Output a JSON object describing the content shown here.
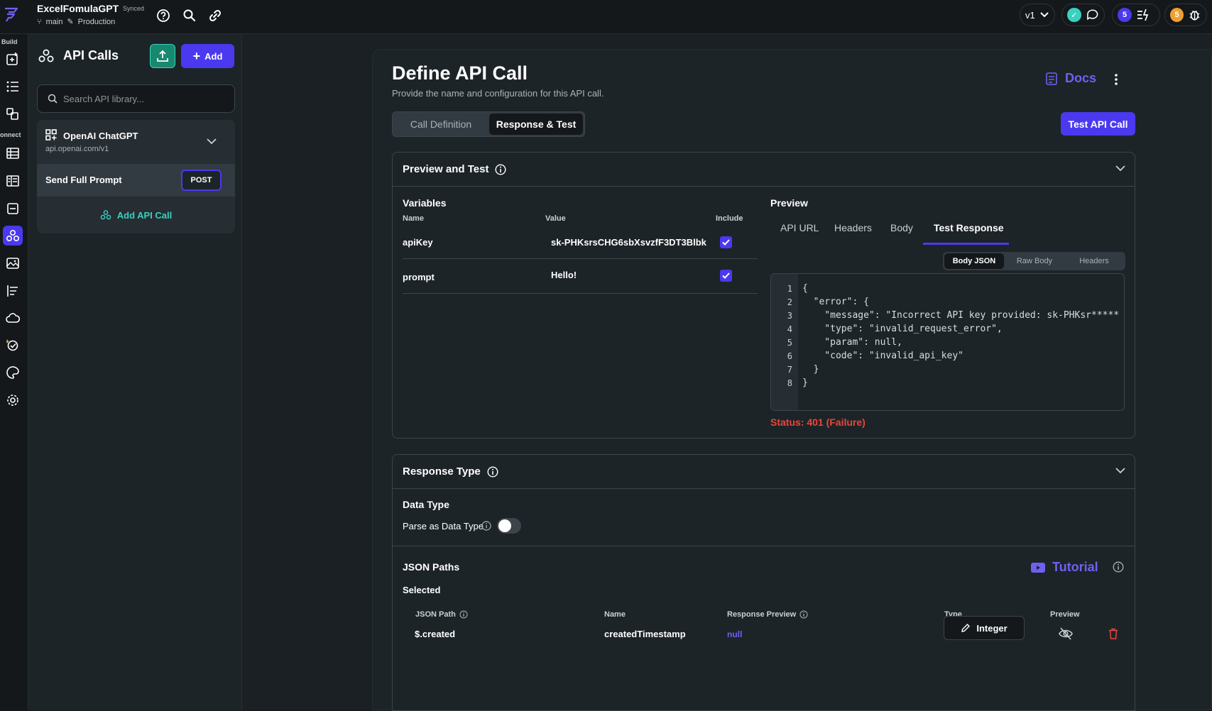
{
  "topbar": {
    "project_name": "ExcelFomulaGPT",
    "sync_status": "Synced",
    "branch": "main",
    "environment": "Production",
    "version": "v1",
    "notif_count_a": "5",
    "notif_count_b": "5"
  },
  "rail": {
    "build_label": "Build",
    "connect_label": "onnect"
  },
  "panel": {
    "title": "API Calls",
    "add_label": "Add",
    "search_placeholder": "Search API library...",
    "group": {
      "name": "OpenAI ChatGPT",
      "url": "api.openai.com/v1"
    },
    "call": {
      "name": "Send Full Prompt",
      "method": "POST"
    },
    "add_call_label": "Add API Call"
  },
  "main": {
    "title": "Define API Call",
    "subtitle": "Provide the name and configuration for this API call.",
    "docs_label": "Docs",
    "tabs": [
      "Call Definition",
      "Response & Test"
    ],
    "test_button": "Test API Call",
    "preview_section": {
      "title": "Preview and Test",
      "variables_title": "Variables",
      "col_name": "Name",
      "col_value": "Value",
      "col_include": "Include",
      "variables": [
        {
          "name": "apiKey",
          "value": "sk-PHKsrsCHG6sbXsvzfF3DT3Blbk",
          "include": true
        },
        {
          "name": "prompt",
          "value": "Hello!",
          "include": true
        }
      ],
      "preview_title": "Preview",
      "preview_tabs": [
        "API URL",
        "Headers",
        "Body",
        "Test Response"
      ],
      "sub_tabs": [
        "Body JSON",
        "Raw Body",
        "Headers"
      ],
      "code_lines": [
        "{",
        "  \"error\": {",
        "    \"message\": \"Incorrect API key provided: sk-PHKsr*****",
        "    \"type\": \"invalid_request_error\",",
        "    \"param\": null,",
        "    \"code\": \"invalid_api_key\"",
        "  }",
        "}"
      ],
      "line_numbers": [
        "1",
        "2",
        "3",
        "4",
        "5",
        "6",
        "7",
        "8"
      ],
      "status_label": "Status:",
      "status_value": "401 (Failure)"
    },
    "response_section": {
      "title": "Response Type",
      "data_type_title": "Data Type",
      "parse_label": "Parse as Data Type",
      "parse_enabled": false,
      "json_paths_title": "JSON Paths",
      "tutorial_label": "Tutorial",
      "selected_label": "Selected",
      "columns": [
        "JSON Path",
        "Name",
        "Response Preview",
        "Type",
        "Preview"
      ],
      "rows": [
        {
          "path": "$.created",
          "name": "createdTimestamp",
          "preview": "null",
          "type": "Integer"
        }
      ]
    }
  },
  "colors": {
    "accent": "#4b39ef",
    "teal": "#39d2c0",
    "error": "#e8473b",
    "background": "#14181b",
    "panel": "#1d2428"
  }
}
